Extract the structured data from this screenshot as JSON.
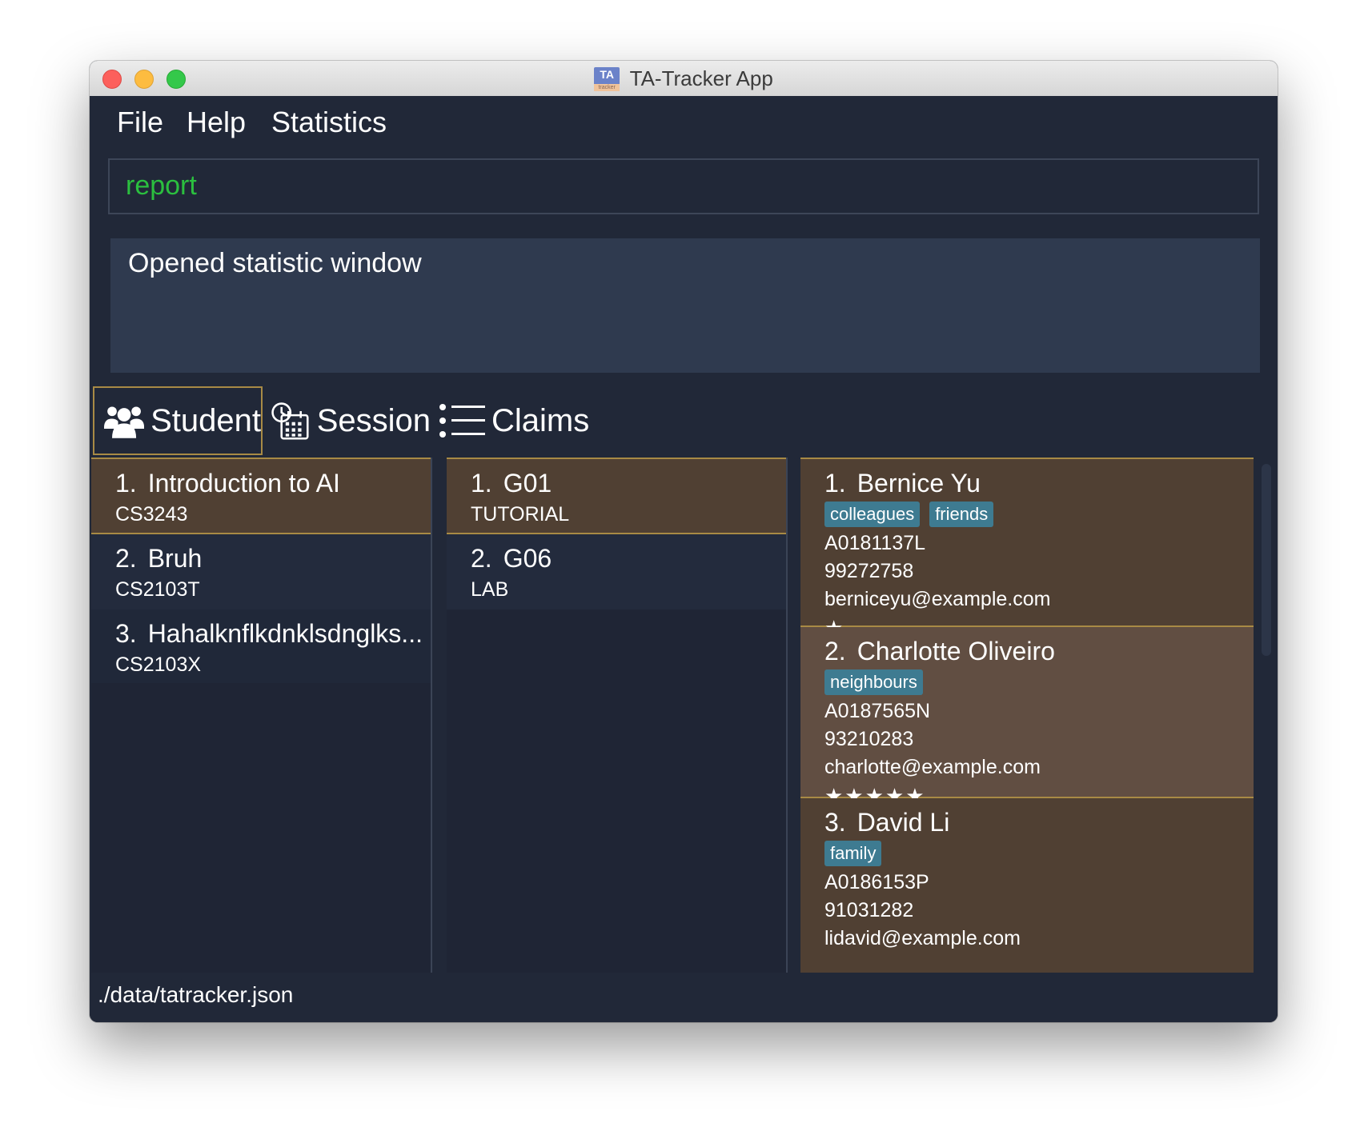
{
  "window": {
    "title": "TA-Tracker App",
    "icon_text": "TA",
    "icon_subtext": "tracker"
  },
  "menu": {
    "file": "File",
    "help": "Help",
    "statistics": "Statistics"
  },
  "command": {
    "value": "report"
  },
  "result": {
    "message": "Opened statistic window"
  },
  "tabs": [
    {
      "label": "Student",
      "icon": "users-icon",
      "active": true
    },
    {
      "label": "Session",
      "icon": "clock-calendar-icon",
      "active": false
    },
    {
      "label": "Claims",
      "icon": "list-icon",
      "active": false
    }
  ],
  "modules": [
    {
      "index": "1.",
      "name": "Introduction to AI",
      "code": "CS3243"
    },
    {
      "index": "2.",
      "name": "Bruh",
      "code": "CS2103T"
    },
    {
      "index": "3.",
      "name": "Hahalknflkdnklsdnglks...",
      "code": "CS2103X"
    }
  ],
  "groups": [
    {
      "index": "1.",
      "name": "G01",
      "type": "TUTORIAL"
    },
    {
      "index": "2.",
      "name": "G06",
      "type": "LAB"
    }
  ],
  "students": [
    {
      "index": "1.",
      "name": "Bernice Yu",
      "tags": [
        "colleagues",
        "friends"
      ],
      "matric": "A0181137L",
      "phone": "99272758",
      "email": "berniceyu@example.com",
      "stars": "★",
      "rating": 1
    },
    {
      "index": "2.",
      "name": "Charlotte Oliveiro",
      "tags": [
        "neighbours"
      ],
      "matric": "A0187565N",
      "phone": "93210283",
      "email": "charlotte@example.com",
      "stars": "★★★★★",
      "rating": 5
    },
    {
      "index": "3.",
      "name": "David Li",
      "tags": [
        "family"
      ],
      "matric": "A0186153P",
      "phone": "91031282",
      "email": "lidavid@example.com",
      "stars": "",
      "rating": 0
    }
  ],
  "status": {
    "path": "./data/tatracker.json"
  },
  "colors": {
    "background": "#212838",
    "selected": "#504033",
    "accent": "#a88a45",
    "tag": "#3e7b91",
    "command_text": "#2bbf3f"
  }
}
